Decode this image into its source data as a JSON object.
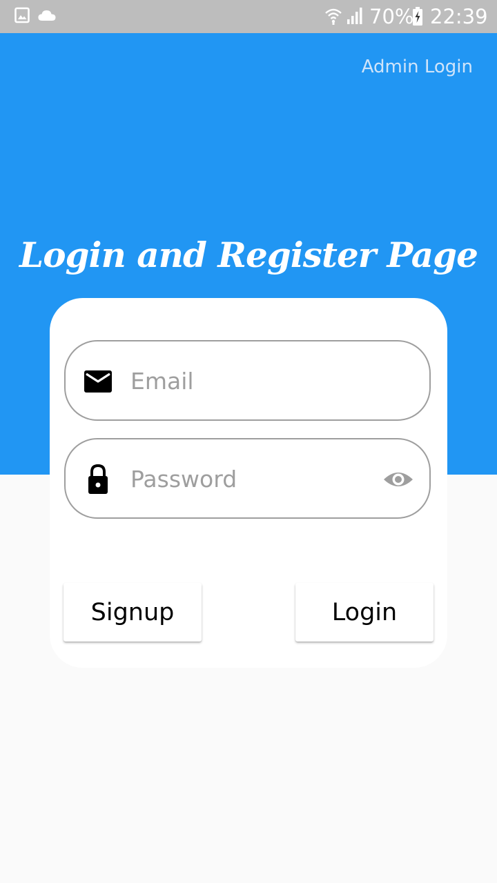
{
  "status_bar": {
    "battery": "70%",
    "time": "22:39",
    "icons": [
      "gallery-icon",
      "cloud-icon",
      "wifi-icon",
      "signal-icon",
      "battery-icon"
    ]
  },
  "header": {
    "admin_link": "Admin Login",
    "title": "Login and Register Page",
    "background_color": "#2196f3"
  },
  "form": {
    "email_placeholder": "Email",
    "email_value": "",
    "password_placeholder": "Password",
    "password_value": "",
    "email_icon": "mail-icon",
    "password_icon": "lock-icon",
    "visibility_icon": "eye-icon"
  },
  "buttons": {
    "signup": "Signup",
    "login": "Login"
  }
}
